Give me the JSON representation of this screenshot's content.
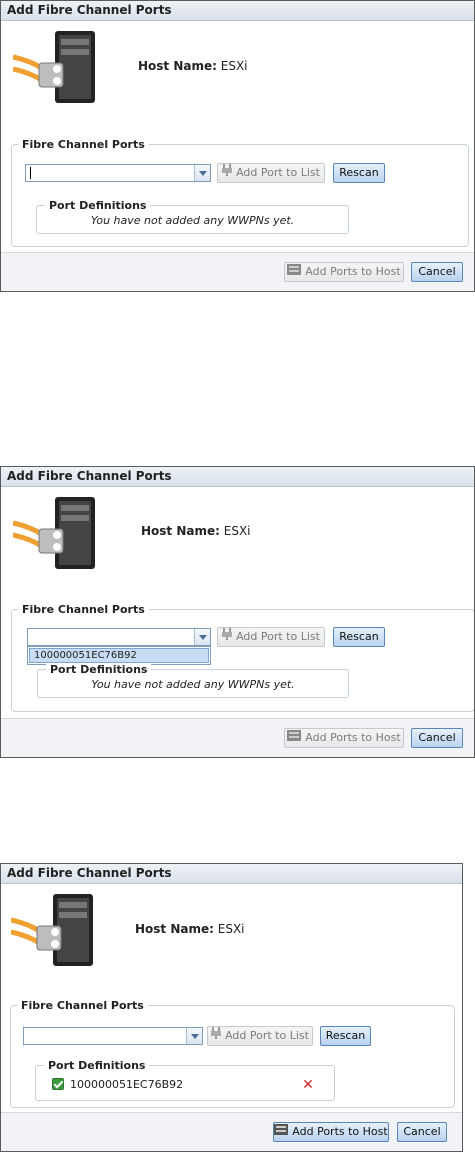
{
  "dialog": {
    "title": "Add Fibre Channel Ports",
    "host_name_label": "Host Name:",
    "host_name_value": "ESXi",
    "section_label": "Fibre Channel Ports",
    "combo_value": "",
    "add_port_label": "Add Port to List",
    "rescan_label": "Rescan",
    "port_defs_label": "Port Definitions",
    "empty_message": "You have not added any WWPNs yet.",
    "add_ports_host_label": "Add Ports to Host",
    "cancel_label": "Cancel"
  },
  "dropdown": {
    "options": [
      "100000051EC76B92"
    ]
  },
  "port_definitions": [
    {
      "wwpn": "100000051EC76B92"
    }
  ]
}
